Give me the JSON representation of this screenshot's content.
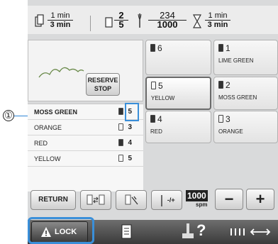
{
  "callout": {
    "number": "①"
  },
  "status": {
    "time_top": "1 min",
    "time_bottom": "3 min",
    "stop_top": "2",
    "stop_bottom": "5",
    "stitch_top": "234",
    "stitch_bottom": "1000",
    "remain_top": "1 min",
    "remain_bottom": "3 min"
  },
  "preview": {
    "reserve_label_1": "RESERVE",
    "reserve_label_2": "STOP"
  },
  "color_list": [
    {
      "name": "MOSS GREEN",
      "needle": "5",
      "spool": "#333333"
    },
    {
      "name": "ORANGE",
      "needle": "3",
      "spool": "#ffffff"
    },
    {
      "name": "RED",
      "needle": "4",
      "spool": "#333333"
    },
    {
      "name": "YELLOW",
      "needle": "5",
      "spool": "#ffffff"
    }
  ],
  "needles": [
    {
      "num": "6",
      "color": ""
    },
    {
      "num": "1",
      "color": "LIME GREEN"
    },
    {
      "num": "5",
      "color": "YELLOW"
    },
    {
      "num": "2",
      "color": "MOSS GREEN"
    },
    {
      "num": "4",
      "color": "RED"
    },
    {
      "num": "3",
      "color": "ORANGE"
    }
  ],
  "toolbar": {
    "return_label": "RETURN",
    "speed_value": "1000",
    "speed_unit": "spm",
    "minus_label": "−",
    "plus_label": "+",
    "needle_adjust_label": "-/+"
  },
  "bottom": {
    "lock_label": "LOCK",
    "help_label": "?"
  },
  "colors": {
    "screen_bg": "#d9dadb",
    "highlight": "#3a8fd9",
    "bottom_bar": "#4a4a4a"
  }
}
